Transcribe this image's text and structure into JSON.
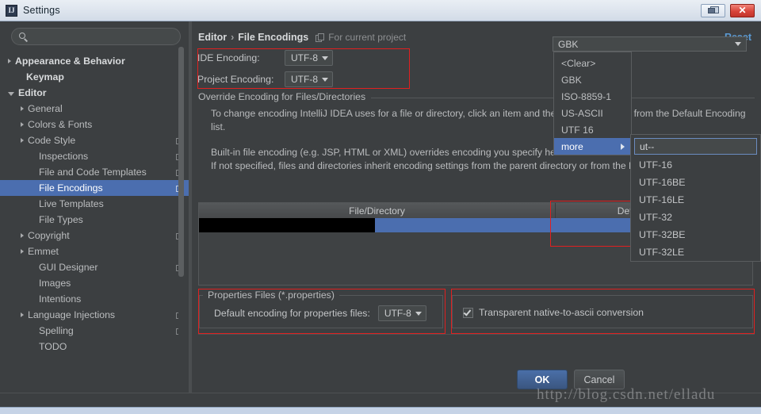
{
  "window": {
    "title": "Settings",
    "icon": "intellij-idea-icon",
    "restore_label": "restore-icon",
    "close_label": "✕"
  },
  "sidebar": {
    "search": {
      "value": "",
      "placeholder": ""
    },
    "items": [
      {
        "label": "Appearance & Behavior",
        "arrow": "right",
        "bold": true,
        "copy": false,
        "selected": false,
        "indent": 10
      },
      {
        "label": "Keymap",
        "arrow": "none",
        "bold": true,
        "copy": false,
        "selected": false,
        "indent": 19
      },
      {
        "label": "Editor",
        "arrow": "down",
        "bold": true,
        "copy": false,
        "selected": false,
        "indent": 10
      },
      {
        "label": "General",
        "arrow": "right",
        "bold": false,
        "copy": false,
        "selected": false,
        "indent": 26
      },
      {
        "label": "Colors & Fonts",
        "arrow": "right",
        "bold": false,
        "copy": false,
        "selected": false,
        "indent": 26
      },
      {
        "label": "Code Style",
        "arrow": "right",
        "bold": false,
        "copy": true,
        "selected": false,
        "indent": 26
      },
      {
        "label": "Inspections",
        "arrow": "none",
        "bold": false,
        "copy": true,
        "selected": false,
        "indent": 35
      },
      {
        "label": "File and Code Templates",
        "arrow": "none",
        "bold": false,
        "copy": true,
        "selected": false,
        "indent": 35
      },
      {
        "label": "File Encodings",
        "arrow": "none",
        "bold": false,
        "copy": true,
        "selected": true,
        "indent": 35
      },
      {
        "label": "Live Templates",
        "arrow": "none",
        "bold": false,
        "copy": false,
        "selected": false,
        "indent": 35
      },
      {
        "label": "File Types",
        "arrow": "none",
        "bold": false,
        "copy": false,
        "selected": false,
        "indent": 35
      },
      {
        "label": "Copyright",
        "arrow": "right",
        "bold": false,
        "copy": true,
        "selected": false,
        "indent": 26
      },
      {
        "label": "Emmet",
        "arrow": "right",
        "bold": false,
        "copy": false,
        "selected": false,
        "indent": 26
      },
      {
        "label": "GUI Designer",
        "arrow": "none",
        "bold": false,
        "copy": true,
        "selected": false,
        "indent": 35
      },
      {
        "label": "Images",
        "arrow": "none",
        "bold": false,
        "copy": false,
        "selected": false,
        "indent": 35
      },
      {
        "label": "Intentions",
        "arrow": "none",
        "bold": false,
        "copy": false,
        "selected": false,
        "indent": 35
      },
      {
        "label": "Language Injections",
        "arrow": "right",
        "bold": false,
        "copy": true,
        "selected": false,
        "indent": 26
      },
      {
        "label": "Spelling",
        "arrow": "none",
        "bold": false,
        "copy": true,
        "selected": false,
        "indent": 35
      },
      {
        "label": "TODO",
        "arrow": "none",
        "bold": false,
        "copy": false,
        "selected": false,
        "indent": 35
      }
    ]
  },
  "breadcrumb": {
    "root": "Editor",
    "separator": "›",
    "page": "File Encodings",
    "scope": "For current project",
    "reset": "Reset"
  },
  "encoding": {
    "ide_label": "IDE Encoding:",
    "ide_value": "UTF-8",
    "project_label": "Project Encoding:",
    "project_value": "UTF-8"
  },
  "override": {
    "title": "Override Encoding for Files/Directories",
    "para1": "To change encoding IntelliJ IDEA uses for a file or directory, click an item and then select encoding from the Default Encoding list.",
    "para2": "Built-in file encoding (e.g. JSP, HTML or XML) overrides encoding you specify here.",
    "para3": "If not specified, files and directories inherit encoding settings from the parent directory or from the Project Encoding."
  },
  "table": {
    "columns": [
      "File/Directory",
      "Default Encoding"
    ],
    "selected_encoding": "GBK"
  },
  "dropdown": {
    "items": [
      "<Clear>",
      "GBK",
      "ISO-8859-1",
      "US-ASCII",
      "UTF 16",
      "more"
    ],
    "highlighted": "more"
  },
  "submenu": {
    "filter_value": "ut--",
    "items": [
      "UTF-16",
      "UTF-16BE",
      "UTF-16LE",
      "UTF-32",
      "UTF-32BE",
      "UTF-32LE"
    ]
  },
  "properties": {
    "group_title": "Properties Files (*.properties)",
    "label": "Default encoding for properties files:",
    "value": "UTF-8",
    "transparent_label": "Transparent native-to-ascii conversion",
    "transparent_checked": true
  },
  "footer": {
    "ok": "OK",
    "cancel": "Cancel"
  },
  "watermark": "http://blog.csdn.net/elladu",
  "colors": {
    "accent_blue": "#4b6eaf",
    "link_blue": "#5b9bd5",
    "annotation_red": "#e02020",
    "panel_bg": "#3c3f41"
  }
}
